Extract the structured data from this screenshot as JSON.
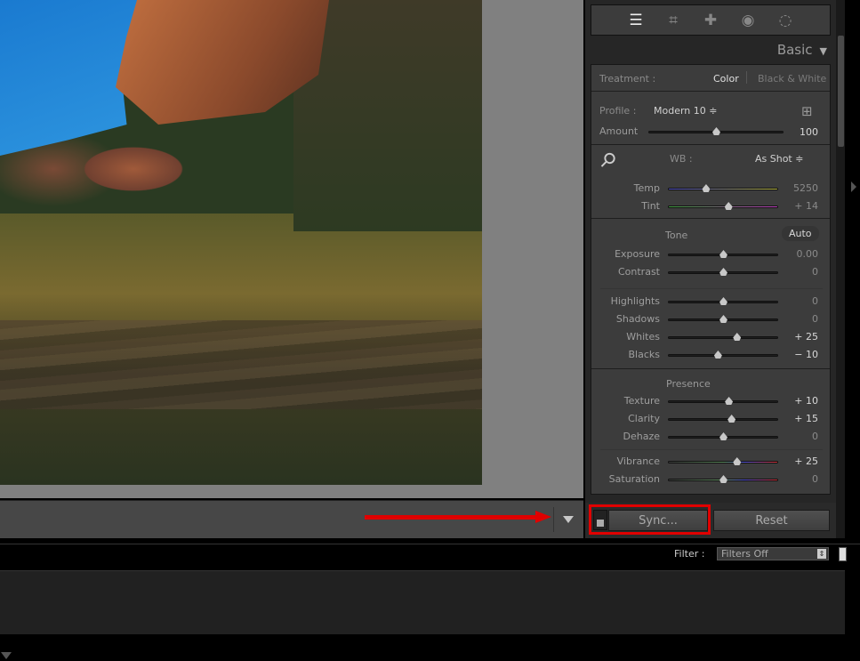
{
  "toolbar": {
    "menu_icon": "triangle-down-icon",
    "annotation_color": "#e00000"
  },
  "tools": [
    "sliders-icon",
    "crop-icon",
    "heal-icon",
    "redeye-icon",
    "mask-icon"
  ],
  "basic": {
    "title": "Basic",
    "treatment_label": "Treatment :",
    "treatment_color": "Color",
    "treatment_bw": "Black & White",
    "profile_label": "Profile :",
    "profile_value": "Modern 10 ≑",
    "amount": {
      "label": "Amount",
      "value": "100",
      "pos": 0.5
    },
    "wb_label": "WB :",
    "wb_value": "As Shot ≑",
    "temp": {
      "label": "Temp",
      "value": "5250",
      "pos": 0.34
    },
    "tint": {
      "label": "Tint",
      "value": "+ 14",
      "pos": 0.547
    },
    "tone_label": "Tone",
    "auto_label": "Auto",
    "exposure": {
      "label": "Exposure",
      "value": "0.00",
      "pos": 0.5
    },
    "contrast": {
      "label": "Contrast",
      "value": "0",
      "pos": 0.5
    },
    "highlights": {
      "label": "Highlights",
      "value": "0",
      "pos": 0.5
    },
    "shadows": {
      "label": "Shadows",
      "value": "0",
      "pos": 0.5
    },
    "whites": {
      "label": "Whites",
      "value": "+ 25",
      "pos": 0.625
    },
    "blacks": {
      "label": "Blacks",
      "value": "− 10",
      "pos": 0.45
    },
    "presence_label": "Presence",
    "texture": {
      "label": "Texture",
      "value": "+ 10",
      "pos": 0.55
    },
    "clarity": {
      "label": "Clarity",
      "value": "+ 15",
      "pos": 0.575
    },
    "dehaze": {
      "label": "Dehaze",
      "value": "0",
      "pos": 0.5
    },
    "vibrance": {
      "label": "Vibrance",
      "value": "+ 25",
      "pos": 0.625
    },
    "saturation": {
      "label": "Saturation",
      "value": "0",
      "pos": 0.5
    }
  },
  "buttons": {
    "sync": "Sync...",
    "reset": "Reset"
  },
  "filter": {
    "label": "Filter :",
    "value": "Filters Off"
  }
}
